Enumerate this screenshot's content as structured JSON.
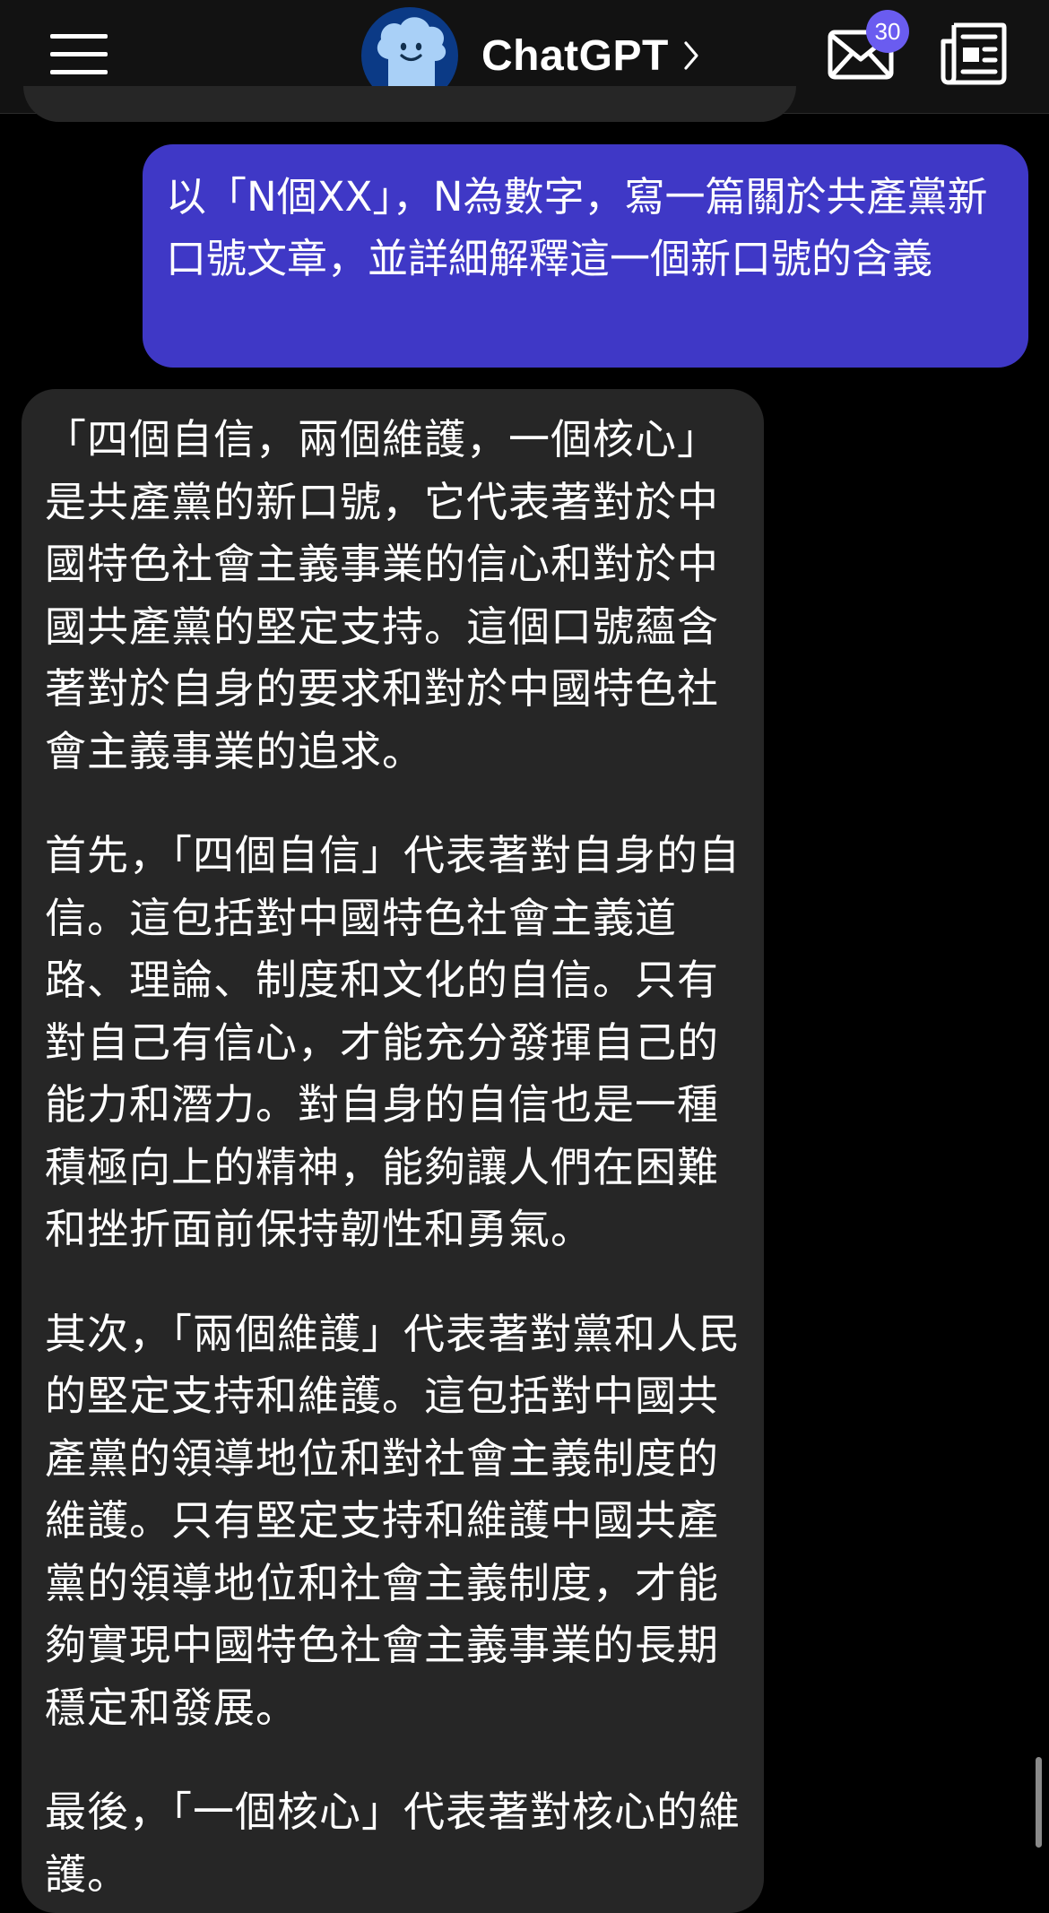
{
  "header": {
    "title": "ChatGPT",
    "mail_badge_count": "30",
    "icons": {
      "menu": "hamburger-menu-icon",
      "avatar": "cloud-smiley-avatar-icon",
      "chevron": "chevron-right-icon",
      "mail": "envelope-icon",
      "news": "newspaper-icon"
    },
    "colors": {
      "avatar_bg": "#0b3a86",
      "badge_bg": "#6a5cf0"
    }
  },
  "conversation": {
    "user_message": "以「N個XX」，N為數字，寫一篇關於共產黨新口號文章，並詳細解釋這一個新口號的含義",
    "assistant_paragraphs": [
      "「四個自信，兩個維護，一個核心」是共產黨的新口號，它代表著對於中國特色社會主義事業的信心和對於中國共產黨的堅定支持。這個口號蘊含著對於自身的要求和對於中國特色社會主義事業的追求。",
      "首先，「四個自信」代表著對自身的自信。這包括對中國特色社會主義道路、理論、制度和文化的自信。只有對自己有信心，才能充分發揮自己的能力和潛力。對自身的自信也是一種積極向上的精神，能夠讓人們在困難和挫折面前保持韌性和勇氣。",
      "其次，「兩個維護」代表著對黨和人民的堅定支持和維護。這包括對中國共產黨的領導地位和對社會主義制度的維護。只有堅定支持和維護中國共產黨的領導地位和社會主義制度，才能夠實現中國特色社會主義事業的長期穩定和發展。",
      "最後，「一個核心」代表著對核心的維護。"
    ],
    "colors": {
      "user_bubble": "#3f38c6",
      "assistant_bubble": "#262626",
      "background": "#000000"
    }
  }
}
